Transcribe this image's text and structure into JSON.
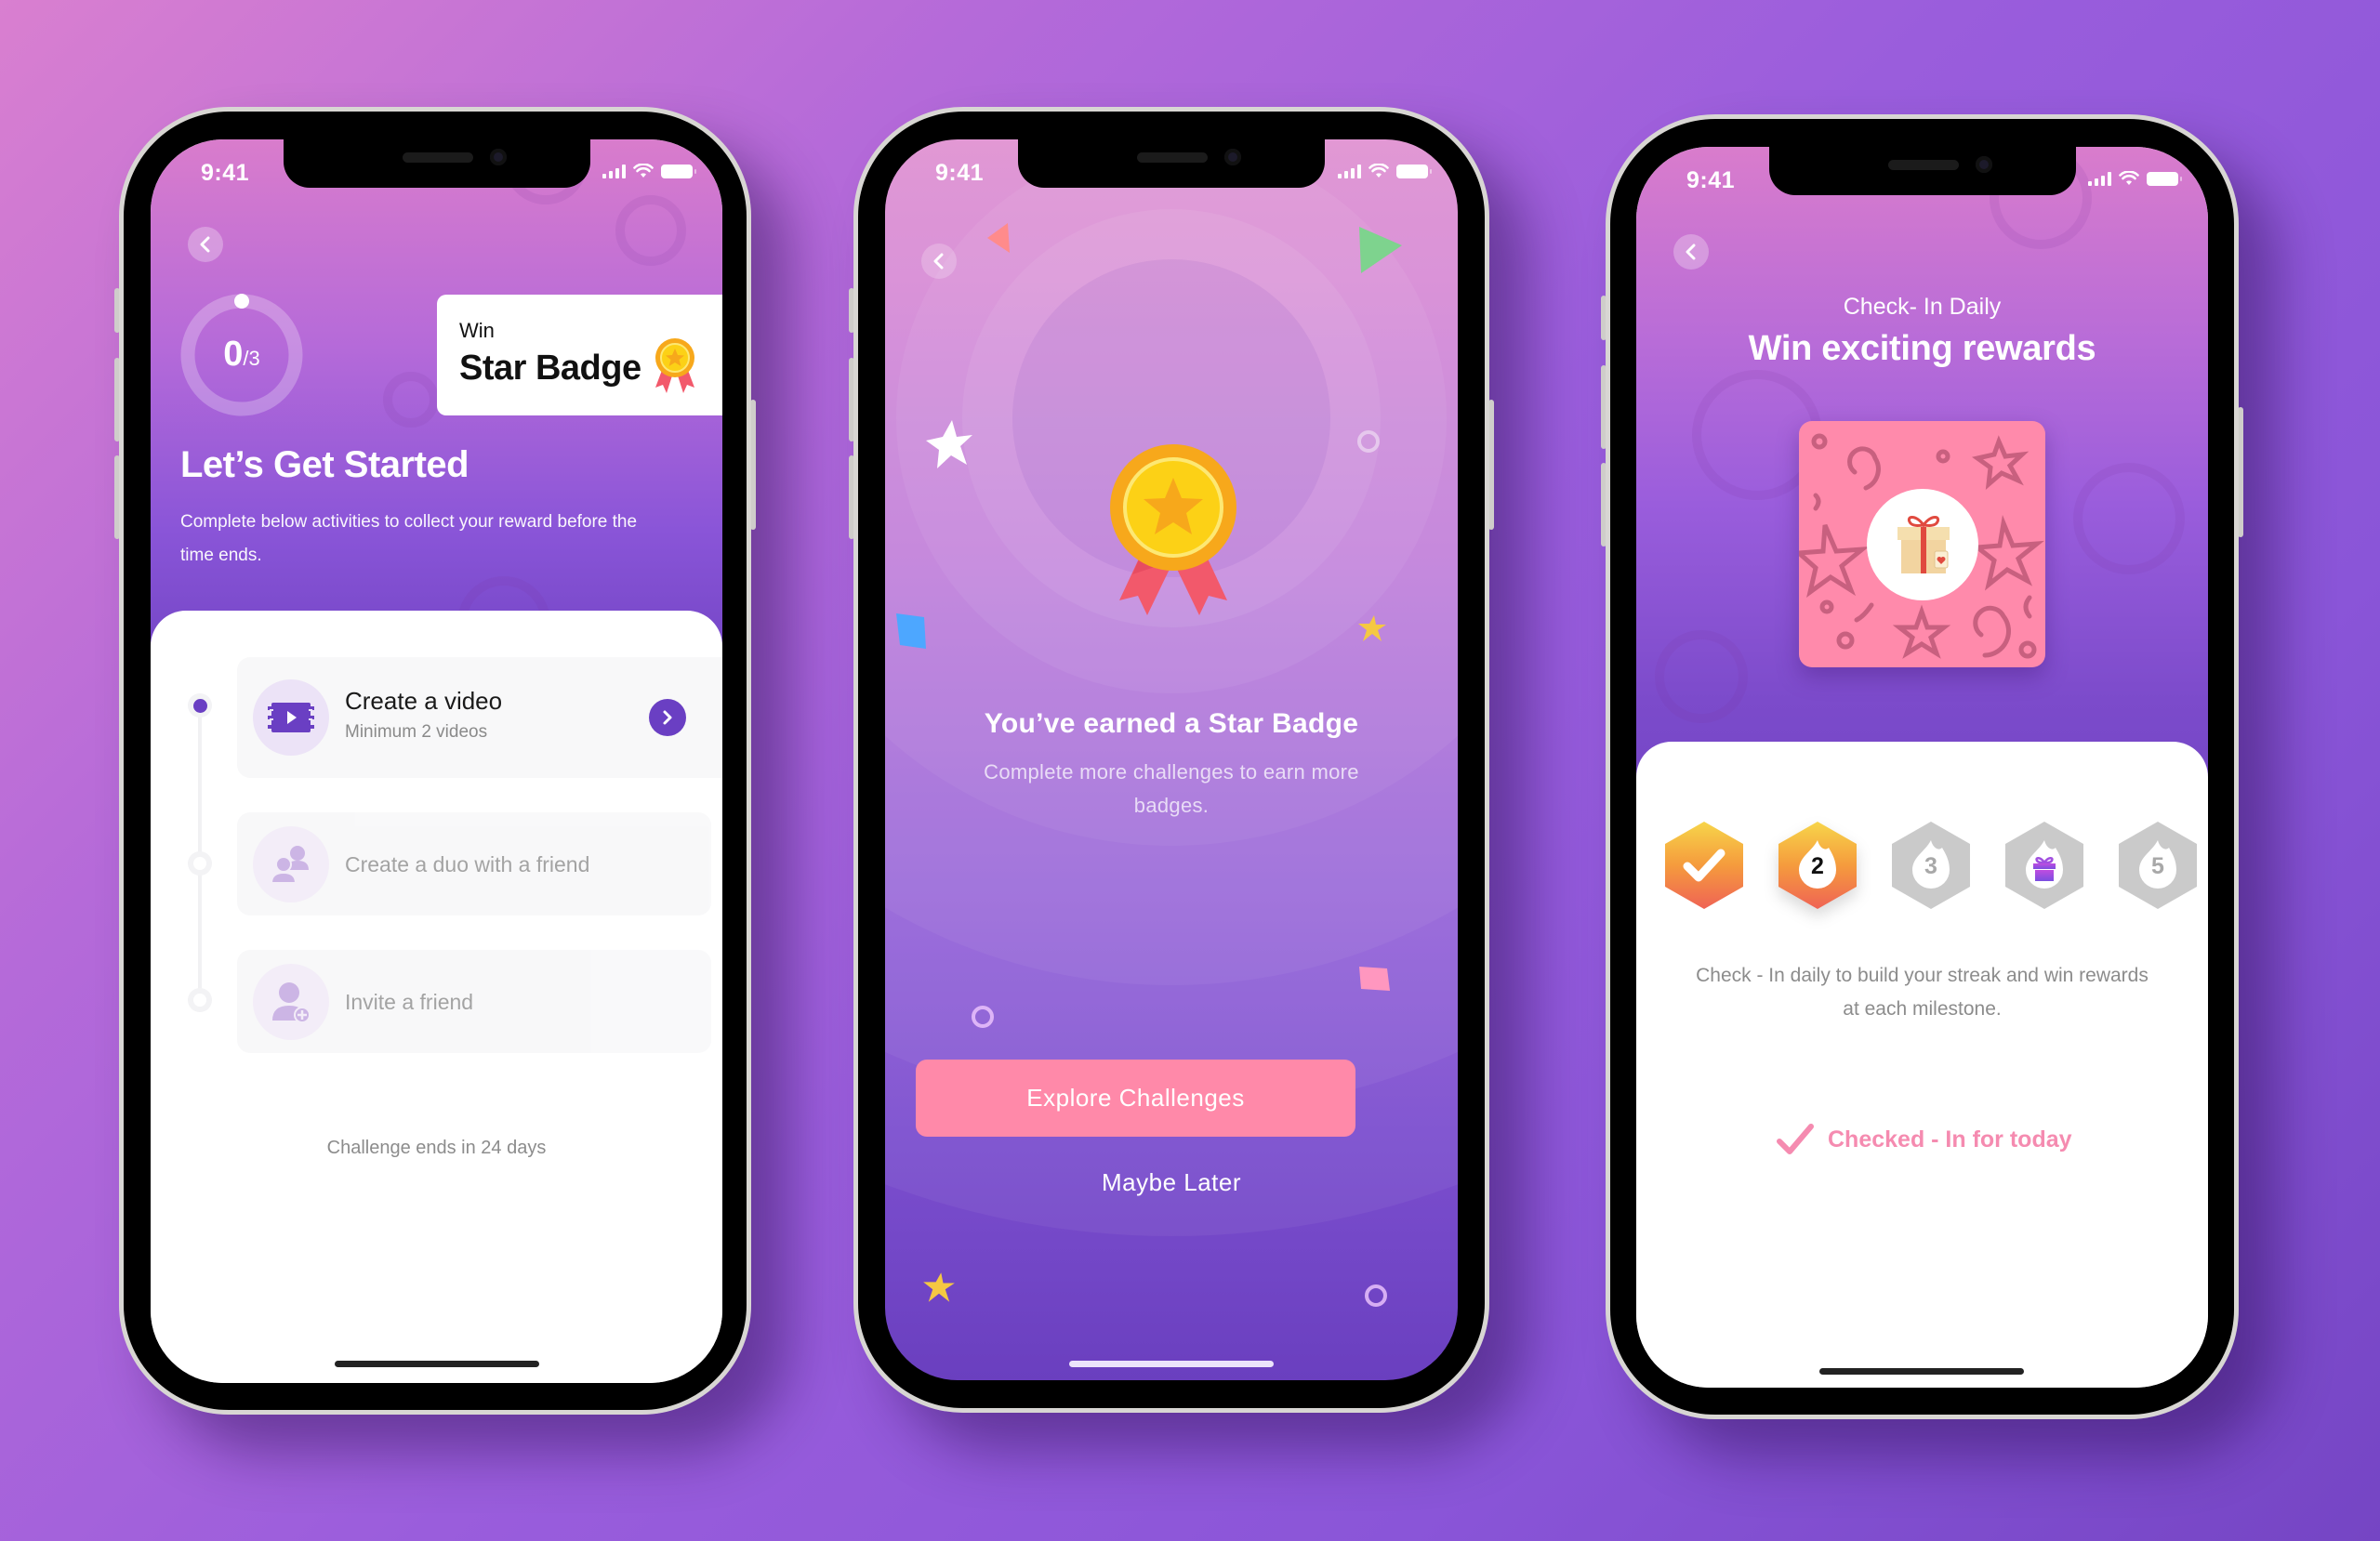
{
  "status_bar": {
    "time": "9:41"
  },
  "screens": {
    "challenge": {
      "progress": {
        "completed": "0",
        "total": "/3",
        "fraction": 0
      },
      "reward_card": {
        "prefix": "Win",
        "title": "Star Badge"
      },
      "heading": "Let’s Get Started",
      "description_line1": "Complete below activities to collect your reward before the",
      "description_line2": "time ends.",
      "tasks": [
        {
          "title": "Create a video",
          "subtitle": "Minimum 2 videos",
          "state": "active",
          "icon": "video-icon"
        },
        {
          "title": "Create a duo with a friend",
          "subtitle": "",
          "state": "locked",
          "icon": "duo-users-icon"
        },
        {
          "title": "Invite a friend",
          "subtitle": "",
          "state": "locked",
          "icon": "add-user-icon"
        }
      ],
      "footer": "Challenge ends in 24 days"
    },
    "badge_earned": {
      "title": "You’ve earned a Star Badge",
      "subtitle_line1": "Complete more challenges to earn more",
      "subtitle_line2": "badges.",
      "primary_button": "Explore Challenges",
      "secondary_button": "Maybe Later"
    },
    "check_in": {
      "eyebrow": "Check- In Daily",
      "title": "Win exciting rewards",
      "streak": [
        {
          "label": "",
          "state": "done",
          "icon": "check-icon"
        },
        {
          "label": "2",
          "state": "current",
          "icon": "flame-icon"
        },
        {
          "label": "3",
          "state": "upcoming",
          "icon": "flame-icon"
        },
        {
          "label": "",
          "state": "reward",
          "icon": "gift-icon"
        },
        {
          "label": "5",
          "state": "upcoming",
          "icon": "flame-icon"
        }
      ],
      "description_line1": "Check - In daily to build your streak and win rewards",
      "description_line2": "at each milestone.",
      "status": "Checked - In for today"
    }
  },
  "colors": {
    "accent_purple": "#6a3fc3",
    "pink": "#ff89a9",
    "status_pink": "#f58bb0",
    "gold": "#f7a81b",
    "ribbon": "#f2596b"
  }
}
